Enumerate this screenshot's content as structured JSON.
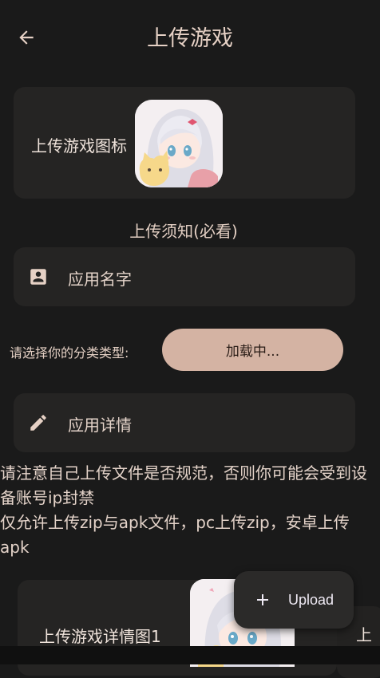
{
  "header": {
    "title": "上传游戏",
    "back_icon": "arrow-left-icon"
  },
  "icon_upload": {
    "label": "上传游戏图标"
  },
  "notice": "上传须知(必看)",
  "app_name": {
    "placeholder": "应用名字",
    "icon": "account-box-icon"
  },
  "category": {
    "label": "请选择你的分类类型:",
    "button": "加载中..."
  },
  "app_detail": {
    "placeholder": "应用详情",
    "icon": "pencil-icon"
  },
  "warnings": [
    "请注意自己上传文件是否规范，否则你可能会受到设备账号ip封禁",
    "仅允许上传zip与apk文件，pc上传zip，安卓上传apk"
  ],
  "detail_images": {
    "label": "上传游戏详情图1",
    "next_label": "上"
  },
  "fab": {
    "label": "Upload",
    "icon": "plus-icon"
  },
  "colors": {
    "background": "#1a1a1a",
    "card": "#252423",
    "accent": "#d4b3a3",
    "text": "#e8d6cc"
  }
}
